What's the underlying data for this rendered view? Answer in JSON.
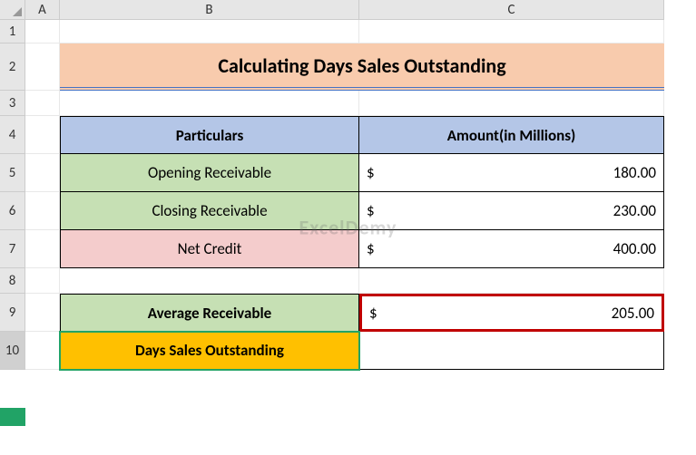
{
  "columns": [
    "A",
    "B",
    "C"
  ],
  "rows": [
    "1",
    "2",
    "3",
    "4",
    "5",
    "6",
    "7",
    "8",
    "9",
    "10"
  ],
  "title": "Calculating Days Sales Outstanding",
  "headers": {
    "particulars": "Particulars",
    "amount": "Amount(in Millions)"
  },
  "data_rows": {
    "opening": {
      "label": "Opening Receivable",
      "currency": "$",
      "value": "180.00"
    },
    "closing": {
      "label": "Closing Receivable",
      "currency": "$",
      "value": "230.00"
    },
    "netcredit": {
      "label": "Net Credit",
      "currency": "$",
      "value": "400.00"
    }
  },
  "summary": {
    "avg_label": "Average Receivable",
    "avg_currency": "$",
    "avg_value": "205.00",
    "dso_label": "Days Sales Outstanding"
  },
  "watermark": "ExcelDemy",
  "chart_data": {
    "type": "table",
    "title": "Calculating Days Sales Outstanding",
    "columns": [
      "Particulars",
      "Amount(in Millions)"
    ],
    "rows": [
      [
        "Opening Receivable",
        180.0
      ],
      [
        "Closing Receivable",
        230.0
      ],
      [
        "Net Credit",
        400.0
      ],
      [
        "Average Receivable",
        205.0
      ],
      [
        "Days Sales Outstanding",
        null
      ]
    ],
    "unit": "USD Millions"
  }
}
